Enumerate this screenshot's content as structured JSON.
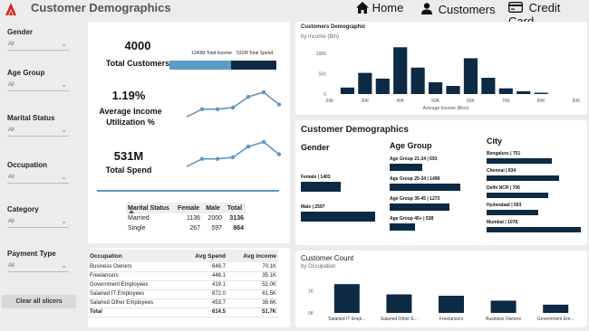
{
  "header": {
    "title": "Customer Demographics",
    "nav": [
      {
        "label": "Home",
        "icon": "home-icon"
      },
      {
        "label": "Customers",
        "icon": "user-icon"
      },
      {
        "label": "Credit Card",
        "icon": "credit-card-icon"
      }
    ]
  },
  "slicers": [
    {
      "label": "Gender",
      "value": "All"
    },
    {
      "label": "Age Group",
      "value": "All"
    },
    {
      "label": "Marital Status",
      "value": "All"
    },
    {
      "label": "Occupation",
      "value": "All"
    },
    {
      "label": "Category",
      "value": "All"
    },
    {
      "label": "Payment Type",
      "value": "All"
    }
  ],
  "clear_label": "Clear all slicers",
  "kpis": {
    "total_customers": {
      "value": "4000",
      "label": "Total Customers"
    },
    "avg_income_util": {
      "value": "1.19%",
      "label": "Average Income Utilization %"
    },
    "total_spend": {
      "value": "531M",
      "label": "Total Spend"
    },
    "income_bar": {
      "income_label": "1240M Total Income",
      "spend_label": "531M Total Spend",
      "spend_fraction": 0.428
    }
  },
  "marital_table": {
    "headers": [
      "Marital Status",
      "Female",
      "Male",
      "Total"
    ],
    "rows": [
      [
        "Married",
        "1136",
        "2000",
        "3136"
      ],
      [
        "Single",
        "267",
        "597",
        "864"
      ]
    ]
  },
  "occupation_table": {
    "headers": [
      "Occupation",
      "Avg Spend",
      "Avg income"
    ],
    "rows": [
      [
        "Business Owners",
        "646.7",
        "70.1K"
      ],
      [
        "Freelancers",
        "446.1",
        "35.1K"
      ],
      [
        "Government Employees",
        "419.1",
        "52.0K"
      ],
      [
        "Salaried IT Employees",
        "872.0",
        "61.5K"
      ],
      [
        "Salaried Other Employees",
        "453.7",
        "38.6K"
      ],
      [
        "Total",
        "614.5",
        "51.7K"
      ]
    ]
  },
  "demographics": {
    "title": "Customer Demographics",
    "gender": {
      "heading": "Gender",
      "items": [
        {
          "label": "Female | 1403",
          "value": 1403
        },
        {
          "label": "Male | 2597",
          "value": 2597
        }
      ]
    },
    "age": {
      "heading": "Age Group",
      "items": [
        {
          "label": "Age Group 21-24 | 691",
          "value": 691
        },
        {
          "label": "Age Group 25-34 | 1498",
          "value": 1498
        },
        {
          "label": "Age Group 35-45 | 1273",
          "value": 1273
        },
        {
          "label": "Age Group 45+ | 538",
          "value": 538
        }
      ]
    },
    "city": {
      "heading": "City",
      "items": [
        {
          "label": "Bengaluru | 751",
          "value": 751
        },
        {
          "label": "Chennai | 834",
          "value": 834
        },
        {
          "label": "Delhi NCR | 706",
          "value": 706
        },
        {
          "label": "Hyderabad | 593",
          "value": 593
        },
        {
          "label": "Mumbai | 1078",
          "value": 1078
        }
      ]
    }
  },
  "chart_data": [
    {
      "type": "bar",
      "title": "Customers Demographic",
      "subtitle": "by Income (Bin)",
      "xlabel": "Average Income (Bins)",
      "x_ticks": [
        "20K",
        "30K",
        "40K",
        "50K",
        "60K",
        "70K",
        "80K",
        "90K"
      ],
      "y_ticks": [
        "0",
        "500",
        "1000"
      ],
      "categories": [
        "25K",
        "30K",
        "35K",
        "40K",
        "45K",
        "50K",
        "55K",
        "60K",
        "65K",
        "70K",
        "75K",
        "80K"
      ],
      "values": [
        160,
        520,
        380,
        1150,
        650,
        290,
        200,
        880,
        400,
        140,
        70,
        0
      ],
      "ylim": [
        0,
        1200
      ]
    },
    {
      "type": "bar",
      "title": "Customer Count",
      "subtitle": "by Occupation",
      "categories": [
        "Salaried IT Empl...",
        "Salaried Other E...",
        "Freelancers",
        "Business Owners",
        "Government Em..."
      ],
      "values": [
        1290,
        830,
        770,
        550,
        370
      ],
      "y_ticks": [
        "0K",
        "1K"
      ],
      "ylim": [
        0,
        1500
      ]
    },
    {
      "type": "line",
      "name": "income-util-sparkline",
      "values": [
        0.2,
        0.45,
        0.45,
        0.5,
        0.85,
        1.0,
        0.6
      ]
    },
    {
      "type": "line",
      "name": "spend-sparkline",
      "values": [
        0.2,
        0.45,
        0.45,
        0.5,
        0.85,
        1.0,
        0.6
      ]
    }
  ],
  "colors": {
    "primary": "#0d2a45",
    "accent": "#5b9bc4",
    "line": "#5e97c2"
  }
}
